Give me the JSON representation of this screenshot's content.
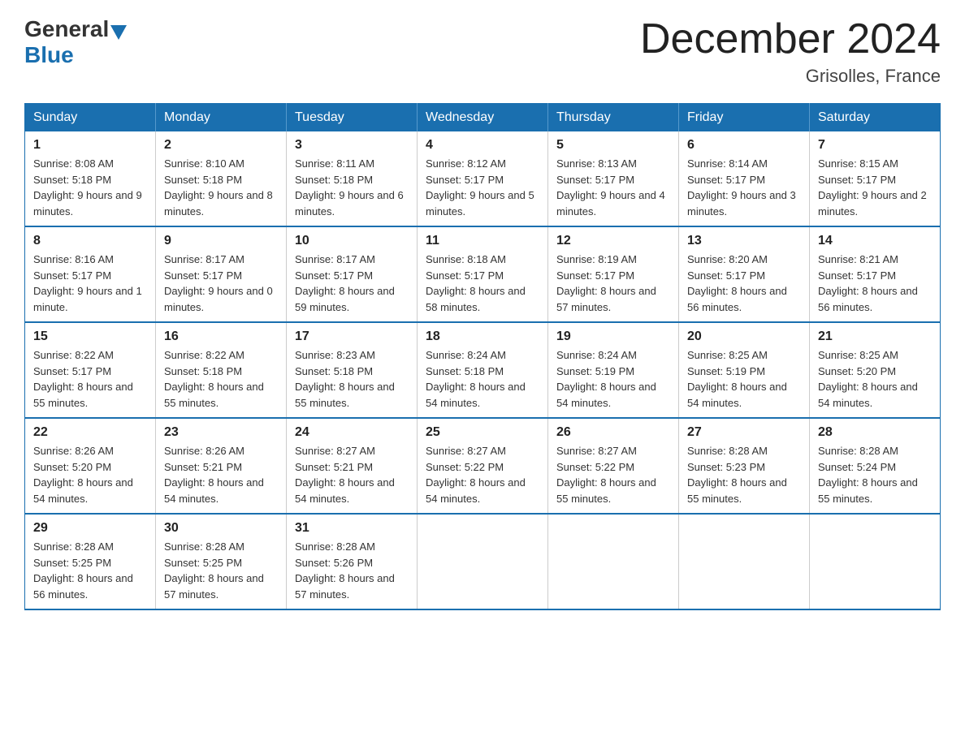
{
  "logo": {
    "general": "General",
    "blue": "Blue"
  },
  "header": {
    "title": "December 2024",
    "location": "Grisolles, France"
  },
  "days_of_week": [
    "Sunday",
    "Monday",
    "Tuesday",
    "Wednesday",
    "Thursday",
    "Friday",
    "Saturday"
  ],
  "weeks": [
    [
      {
        "day": "1",
        "sunrise": "8:08 AM",
        "sunset": "5:18 PM",
        "daylight": "9 hours and 9 minutes."
      },
      {
        "day": "2",
        "sunrise": "8:10 AM",
        "sunset": "5:18 PM",
        "daylight": "9 hours and 8 minutes."
      },
      {
        "day": "3",
        "sunrise": "8:11 AM",
        "sunset": "5:18 PM",
        "daylight": "9 hours and 6 minutes."
      },
      {
        "day": "4",
        "sunrise": "8:12 AM",
        "sunset": "5:17 PM",
        "daylight": "9 hours and 5 minutes."
      },
      {
        "day": "5",
        "sunrise": "8:13 AM",
        "sunset": "5:17 PM",
        "daylight": "9 hours and 4 minutes."
      },
      {
        "day": "6",
        "sunrise": "8:14 AM",
        "sunset": "5:17 PM",
        "daylight": "9 hours and 3 minutes."
      },
      {
        "day": "7",
        "sunrise": "8:15 AM",
        "sunset": "5:17 PM",
        "daylight": "9 hours and 2 minutes."
      }
    ],
    [
      {
        "day": "8",
        "sunrise": "8:16 AM",
        "sunset": "5:17 PM",
        "daylight": "9 hours and 1 minute."
      },
      {
        "day": "9",
        "sunrise": "8:17 AM",
        "sunset": "5:17 PM",
        "daylight": "9 hours and 0 minutes."
      },
      {
        "day": "10",
        "sunrise": "8:17 AM",
        "sunset": "5:17 PM",
        "daylight": "8 hours and 59 minutes."
      },
      {
        "day": "11",
        "sunrise": "8:18 AM",
        "sunset": "5:17 PM",
        "daylight": "8 hours and 58 minutes."
      },
      {
        "day": "12",
        "sunrise": "8:19 AM",
        "sunset": "5:17 PM",
        "daylight": "8 hours and 57 minutes."
      },
      {
        "day": "13",
        "sunrise": "8:20 AM",
        "sunset": "5:17 PM",
        "daylight": "8 hours and 56 minutes."
      },
      {
        "day": "14",
        "sunrise": "8:21 AM",
        "sunset": "5:17 PM",
        "daylight": "8 hours and 56 minutes."
      }
    ],
    [
      {
        "day": "15",
        "sunrise": "8:22 AM",
        "sunset": "5:17 PM",
        "daylight": "8 hours and 55 minutes."
      },
      {
        "day": "16",
        "sunrise": "8:22 AM",
        "sunset": "5:18 PM",
        "daylight": "8 hours and 55 minutes."
      },
      {
        "day": "17",
        "sunrise": "8:23 AM",
        "sunset": "5:18 PM",
        "daylight": "8 hours and 55 minutes."
      },
      {
        "day": "18",
        "sunrise": "8:24 AM",
        "sunset": "5:18 PM",
        "daylight": "8 hours and 54 minutes."
      },
      {
        "day": "19",
        "sunrise": "8:24 AM",
        "sunset": "5:19 PM",
        "daylight": "8 hours and 54 minutes."
      },
      {
        "day": "20",
        "sunrise": "8:25 AM",
        "sunset": "5:19 PM",
        "daylight": "8 hours and 54 minutes."
      },
      {
        "day": "21",
        "sunrise": "8:25 AM",
        "sunset": "5:20 PM",
        "daylight": "8 hours and 54 minutes."
      }
    ],
    [
      {
        "day": "22",
        "sunrise": "8:26 AM",
        "sunset": "5:20 PM",
        "daylight": "8 hours and 54 minutes."
      },
      {
        "day": "23",
        "sunrise": "8:26 AM",
        "sunset": "5:21 PM",
        "daylight": "8 hours and 54 minutes."
      },
      {
        "day": "24",
        "sunrise": "8:27 AM",
        "sunset": "5:21 PM",
        "daylight": "8 hours and 54 minutes."
      },
      {
        "day": "25",
        "sunrise": "8:27 AM",
        "sunset": "5:22 PM",
        "daylight": "8 hours and 54 minutes."
      },
      {
        "day": "26",
        "sunrise": "8:27 AM",
        "sunset": "5:22 PM",
        "daylight": "8 hours and 55 minutes."
      },
      {
        "day": "27",
        "sunrise": "8:28 AM",
        "sunset": "5:23 PM",
        "daylight": "8 hours and 55 minutes."
      },
      {
        "day": "28",
        "sunrise": "8:28 AM",
        "sunset": "5:24 PM",
        "daylight": "8 hours and 55 minutes."
      }
    ],
    [
      {
        "day": "29",
        "sunrise": "8:28 AM",
        "sunset": "5:25 PM",
        "daylight": "8 hours and 56 minutes."
      },
      {
        "day": "30",
        "sunrise": "8:28 AM",
        "sunset": "5:25 PM",
        "daylight": "8 hours and 57 minutes."
      },
      {
        "day": "31",
        "sunrise": "8:28 AM",
        "sunset": "5:26 PM",
        "daylight": "8 hours and 57 minutes."
      },
      null,
      null,
      null,
      null
    ]
  ],
  "labels": {
    "sunrise": "Sunrise:",
    "sunset": "Sunset:",
    "daylight": "Daylight:"
  }
}
